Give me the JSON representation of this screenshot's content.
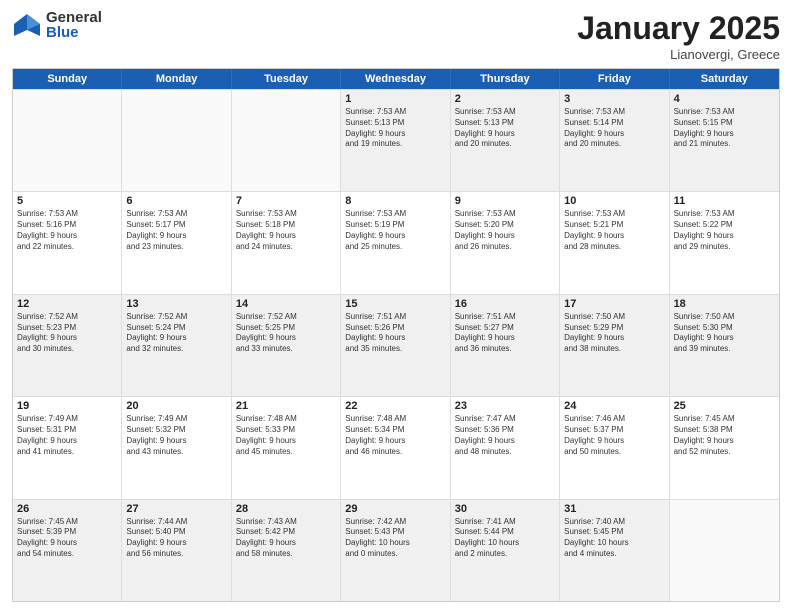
{
  "logo": {
    "general": "General",
    "blue": "Blue"
  },
  "header": {
    "title": "January 2025",
    "subtitle": "Lianovergi, Greece"
  },
  "days": [
    "Sunday",
    "Monday",
    "Tuesday",
    "Wednesday",
    "Thursday",
    "Friday",
    "Saturday"
  ],
  "rows": [
    [
      {
        "day": "",
        "info": ""
      },
      {
        "day": "",
        "info": ""
      },
      {
        "day": "",
        "info": ""
      },
      {
        "day": "1",
        "info": "Sunrise: 7:53 AM\nSunset: 5:13 PM\nDaylight: 9 hours\nand 19 minutes."
      },
      {
        "day": "2",
        "info": "Sunrise: 7:53 AM\nSunset: 5:13 PM\nDaylight: 9 hours\nand 20 minutes."
      },
      {
        "day": "3",
        "info": "Sunrise: 7:53 AM\nSunset: 5:14 PM\nDaylight: 9 hours\nand 20 minutes."
      },
      {
        "day": "4",
        "info": "Sunrise: 7:53 AM\nSunset: 5:15 PM\nDaylight: 9 hours\nand 21 minutes."
      }
    ],
    [
      {
        "day": "5",
        "info": "Sunrise: 7:53 AM\nSunset: 5:16 PM\nDaylight: 9 hours\nand 22 minutes."
      },
      {
        "day": "6",
        "info": "Sunrise: 7:53 AM\nSunset: 5:17 PM\nDaylight: 9 hours\nand 23 minutes."
      },
      {
        "day": "7",
        "info": "Sunrise: 7:53 AM\nSunset: 5:18 PM\nDaylight: 9 hours\nand 24 minutes."
      },
      {
        "day": "8",
        "info": "Sunrise: 7:53 AM\nSunset: 5:19 PM\nDaylight: 9 hours\nand 25 minutes."
      },
      {
        "day": "9",
        "info": "Sunrise: 7:53 AM\nSunset: 5:20 PM\nDaylight: 9 hours\nand 26 minutes."
      },
      {
        "day": "10",
        "info": "Sunrise: 7:53 AM\nSunset: 5:21 PM\nDaylight: 9 hours\nand 28 minutes."
      },
      {
        "day": "11",
        "info": "Sunrise: 7:53 AM\nSunset: 5:22 PM\nDaylight: 9 hours\nand 29 minutes."
      }
    ],
    [
      {
        "day": "12",
        "info": "Sunrise: 7:52 AM\nSunset: 5:23 PM\nDaylight: 9 hours\nand 30 minutes."
      },
      {
        "day": "13",
        "info": "Sunrise: 7:52 AM\nSunset: 5:24 PM\nDaylight: 9 hours\nand 32 minutes."
      },
      {
        "day": "14",
        "info": "Sunrise: 7:52 AM\nSunset: 5:25 PM\nDaylight: 9 hours\nand 33 minutes."
      },
      {
        "day": "15",
        "info": "Sunrise: 7:51 AM\nSunset: 5:26 PM\nDaylight: 9 hours\nand 35 minutes."
      },
      {
        "day": "16",
        "info": "Sunrise: 7:51 AM\nSunset: 5:27 PM\nDaylight: 9 hours\nand 36 minutes."
      },
      {
        "day": "17",
        "info": "Sunrise: 7:50 AM\nSunset: 5:29 PM\nDaylight: 9 hours\nand 38 minutes."
      },
      {
        "day": "18",
        "info": "Sunrise: 7:50 AM\nSunset: 5:30 PM\nDaylight: 9 hours\nand 39 minutes."
      }
    ],
    [
      {
        "day": "19",
        "info": "Sunrise: 7:49 AM\nSunset: 5:31 PM\nDaylight: 9 hours\nand 41 minutes."
      },
      {
        "day": "20",
        "info": "Sunrise: 7:49 AM\nSunset: 5:32 PM\nDaylight: 9 hours\nand 43 minutes."
      },
      {
        "day": "21",
        "info": "Sunrise: 7:48 AM\nSunset: 5:33 PM\nDaylight: 9 hours\nand 45 minutes."
      },
      {
        "day": "22",
        "info": "Sunrise: 7:48 AM\nSunset: 5:34 PM\nDaylight: 9 hours\nand 46 minutes."
      },
      {
        "day": "23",
        "info": "Sunrise: 7:47 AM\nSunset: 5:36 PM\nDaylight: 9 hours\nand 48 minutes."
      },
      {
        "day": "24",
        "info": "Sunrise: 7:46 AM\nSunset: 5:37 PM\nDaylight: 9 hours\nand 50 minutes."
      },
      {
        "day": "25",
        "info": "Sunrise: 7:45 AM\nSunset: 5:38 PM\nDaylight: 9 hours\nand 52 minutes."
      }
    ],
    [
      {
        "day": "26",
        "info": "Sunrise: 7:45 AM\nSunset: 5:39 PM\nDaylight: 9 hours\nand 54 minutes."
      },
      {
        "day": "27",
        "info": "Sunrise: 7:44 AM\nSunset: 5:40 PM\nDaylight: 9 hours\nand 56 minutes."
      },
      {
        "day": "28",
        "info": "Sunrise: 7:43 AM\nSunset: 5:42 PM\nDaylight: 9 hours\nand 58 minutes."
      },
      {
        "day": "29",
        "info": "Sunrise: 7:42 AM\nSunset: 5:43 PM\nDaylight: 10 hours\nand 0 minutes."
      },
      {
        "day": "30",
        "info": "Sunrise: 7:41 AM\nSunset: 5:44 PM\nDaylight: 10 hours\nand 2 minutes."
      },
      {
        "day": "31",
        "info": "Sunrise: 7:40 AM\nSunset: 5:45 PM\nDaylight: 10 hours\nand 4 minutes."
      },
      {
        "day": "",
        "info": ""
      }
    ]
  ]
}
